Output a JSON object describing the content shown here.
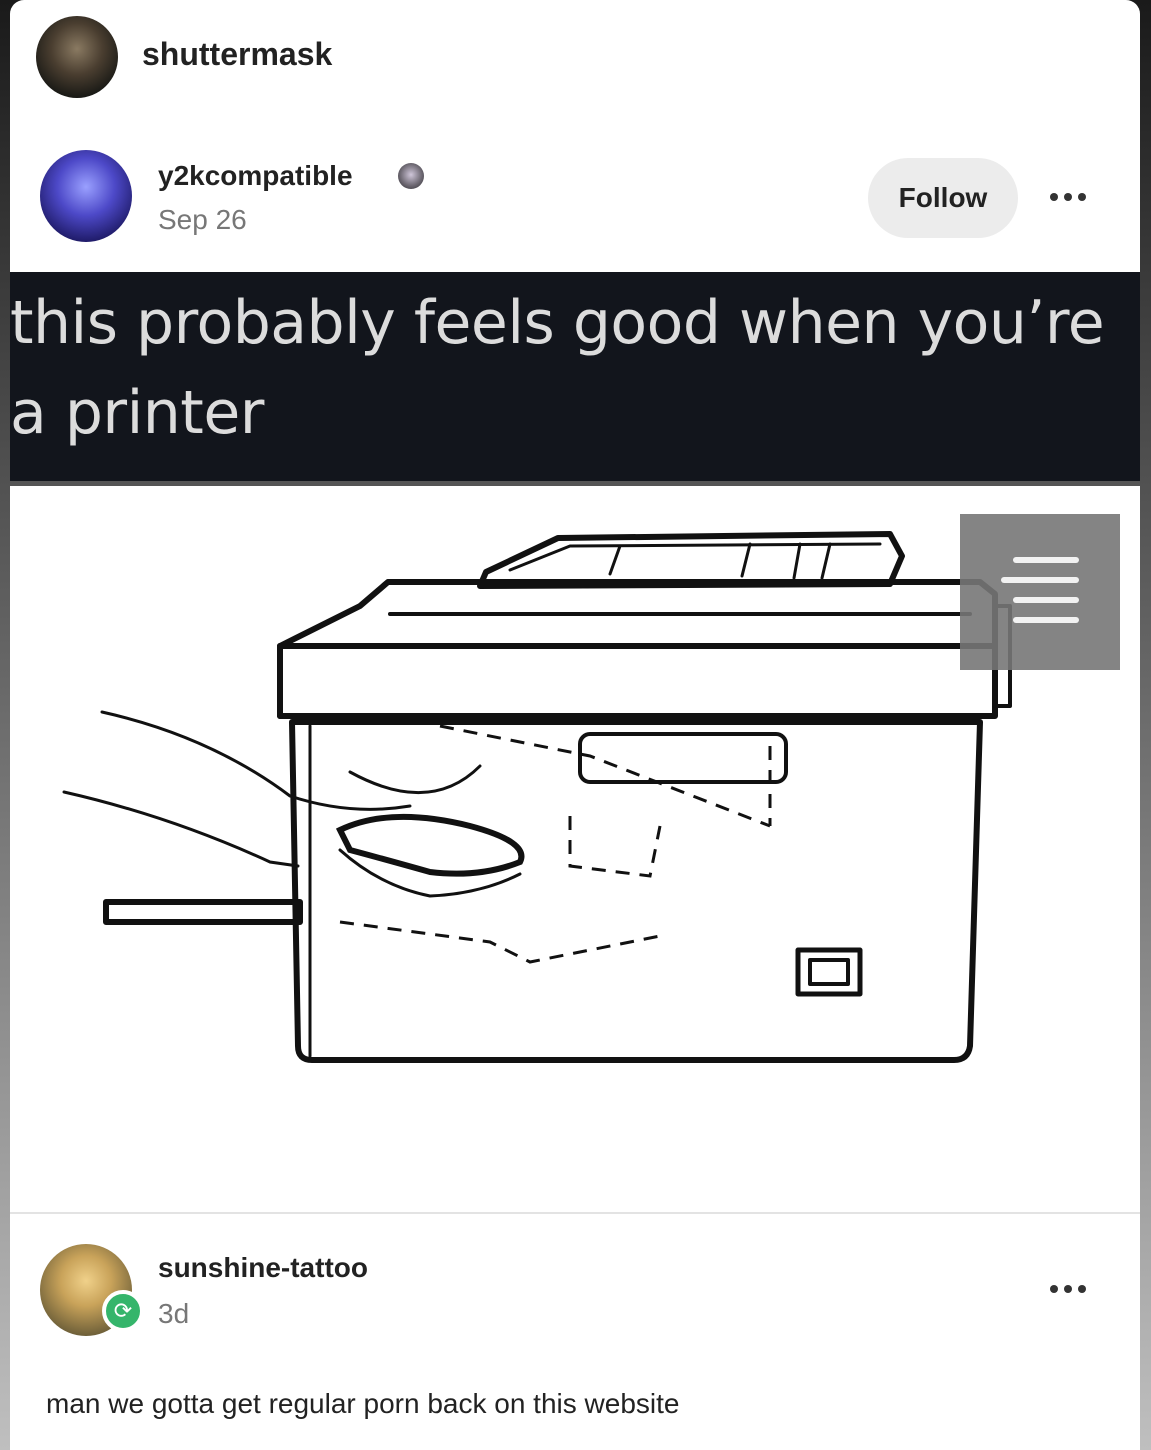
{
  "reblogger": {
    "username": "shuttermask"
  },
  "post": {
    "author": "y2kcompatible",
    "date": "Sep 26",
    "follow_label": "Follow",
    "caption": "this probably feels good when you’re a printer",
    "image": {
      "subject": "printer-with-hand-illustration"
    }
  },
  "reply": {
    "author": "sunshine-tattoo",
    "time": "3d",
    "text": "man we gotta get regular porn back on this website"
  },
  "icons": {
    "more": "ellipsis-icon",
    "badge": "blog-badge-icon",
    "reblog": "reblog-icon",
    "menu": "paper-lines-icon"
  },
  "colors": {
    "caption_band": "#12151c",
    "caption_text": "#dcdcdc",
    "reblog_green": "#35b56b",
    "follow_bg": "#ececec"
  }
}
